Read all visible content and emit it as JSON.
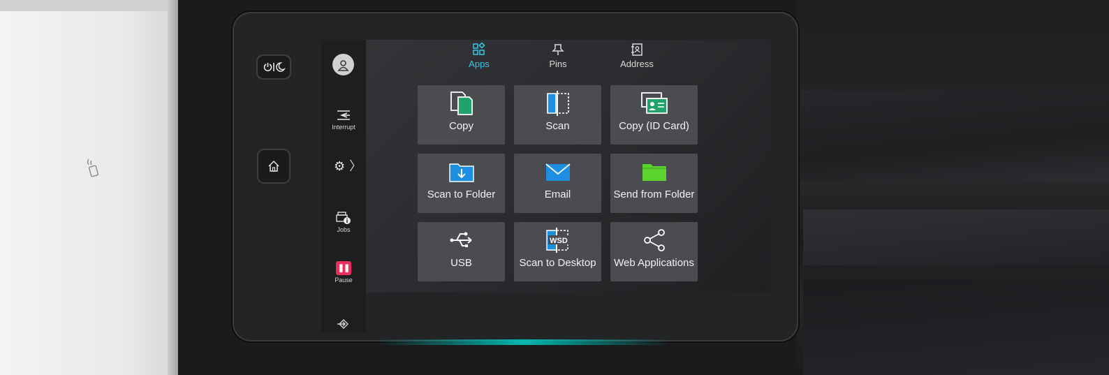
{
  "colors": {
    "accent": "#36c8e8",
    "tile_bg": "#4a4c50",
    "pause_red": "#e8305a",
    "copy_green": "#1fa36a",
    "scan_blue": "#1e8fe0",
    "folder_green": "#5cd32e"
  },
  "hardware": {
    "power_button_icon": "power-sleep-icon",
    "home_button_icon": "home-icon"
  },
  "left_rail": {
    "avatar_icon": "user-icon",
    "interrupt_label": "Interrupt",
    "settings_icon": "gear-icon",
    "jobs_label": "Jobs",
    "pause_label": "Pause",
    "bottom_icon": "login-arrow-icon"
  },
  "tabs": [
    {
      "label": "Apps",
      "icon": "apps-grid-icon",
      "active": true
    },
    {
      "label": "Pins",
      "icon": "pin-icon",
      "active": false
    },
    {
      "label": "Address",
      "icon": "address-book-icon",
      "active": false
    }
  ],
  "tiles": [
    {
      "label": "Copy",
      "icon": "copy-icon"
    },
    {
      "label": "Scan",
      "icon": "scan-icon"
    },
    {
      "label": "Copy (ID Card)",
      "icon": "id-card-icon"
    },
    {
      "label": "Scan to Folder",
      "icon": "scan-to-folder-icon"
    },
    {
      "label": "Email",
      "icon": "email-icon"
    },
    {
      "label": "Send from Folder",
      "icon": "folder-icon"
    },
    {
      "label": "USB",
      "icon": "usb-icon"
    },
    {
      "label": "Scan to Desktop",
      "icon": "wsd-icon"
    },
    {
      "label": "Web Applications",
      "icon": "share-icon"
    }
  ]
}
